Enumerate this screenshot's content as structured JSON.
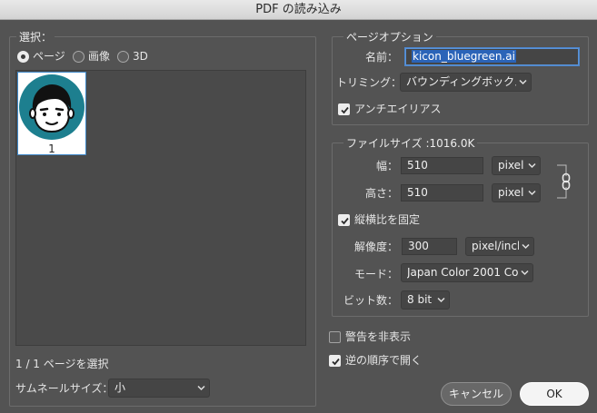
{
  "window": {
    "title": "PDF の読み込み"
  },
  "select_panel": {
    "legend": "選択：",
    "radios": [
      {
        "label": "ページ",
        "selected": true
      },
      {
        "label": "画像",
        "selected": false
      },
      {
        "label": "3D",
        "selected": false
      }
    ],
    "thumbnail": {
      "page_number": "1"
    },
    "status": "1 / 1 ページを選択",
    "thumb_size_label": "サムネールサイズ：",
    "thumb_size_value": "小"
  },
  "page_options": {
    "legend": "ページオプション",
    "name_label": "名前：",
    "name_value": "kicon_bluegreen.ai",
    "trim_label": "トリミング：",
    "trim_value": "バウンディングボックス",
    "antialias_label": "アンチエイリアス",
    "antialias_checked": true
  },
  "file_size": {
    "legend": "ファイルサイズ :1016.0K",
    "width_label": "幅：",
    "width_value": "510",
    "width_unit": "pixel",
    "height_label": "高さ：",
    "height_value": "510",
    "height_unit": "pixel",
    "constrain_label": "縦横比を固定",
    "constrain_checked": true,
    "resolution_label": "解像度：",
    "resolution_value": "300",
    "resolution_unit": "pixel/inch",
    "mode_label": "モード：",
    "mode_value": "Japan Color 2001 Co...",
    "bits_label": "ビット数：",
    "bits_value": "8 bit"
  },
  "options": {
    "suppress_warnings_label": "警告を非表示",
    "suppress_warnings_checked": false,
    "reverse_order_label": "逆の順序で開く",
    "reverse_order_checked": true
  },
  "buttons": {
    "cancel": "キャンセル",
    "ok": "OK"
  },
  "colors": {
    "accent": "#2b64b8",
    "avatar_ring": "#1d7f8f",
    "window_bg": "#535353"
  }
}
